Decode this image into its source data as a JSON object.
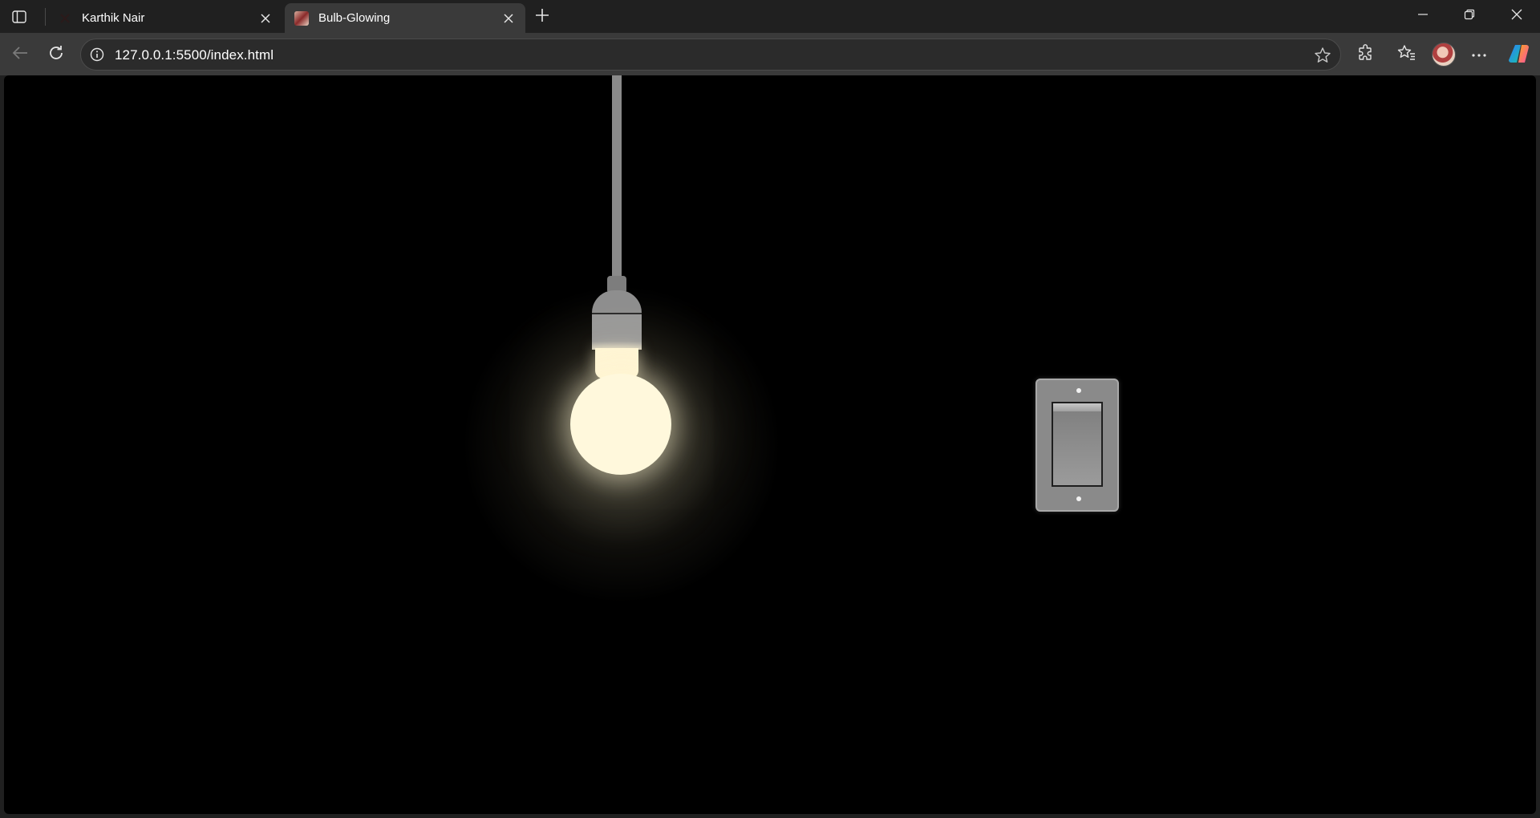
{
  "browser": {
    "tabs": [
      {
        "title": "Karthik Nair",
        "active": false,
        "favicon": "x-logo-icon"
      },
      {
        "title": "Bulb-Glowing",
        "active": true,
        "favicon": "profile-image-icon"
      }
    ],
    "address_bar": {
      "url": "127.0.0.1:5500/index.html"
    },
    "icons": {
      "sidebar": "sidebar-toggle-icon",
      "new_tab": "plus-icon",
      "back": "back-arrow-icon",
      "refresh": "refresh-icon",
      "site_info": "info-icon",
      "favorite": "star-icon",
      "extensions": "puzzle-icon",
      "favorites": "favorites-icon",
      "more": "more-icon",
      "copilot": "copilot-icon",
      "minimize": "minimize-icon",
      "restore": "restore-icon",
      "close": "close-icon"
    }
  },
  "page": {
    "bulb_state": "on",
    "colors": {
      "background": "#000000",
      "bulb_light": "#fff8dc",
      "cord": "#8a8a8a",
      "switch_plate": "#8a8a8a"
    }
  }
}
